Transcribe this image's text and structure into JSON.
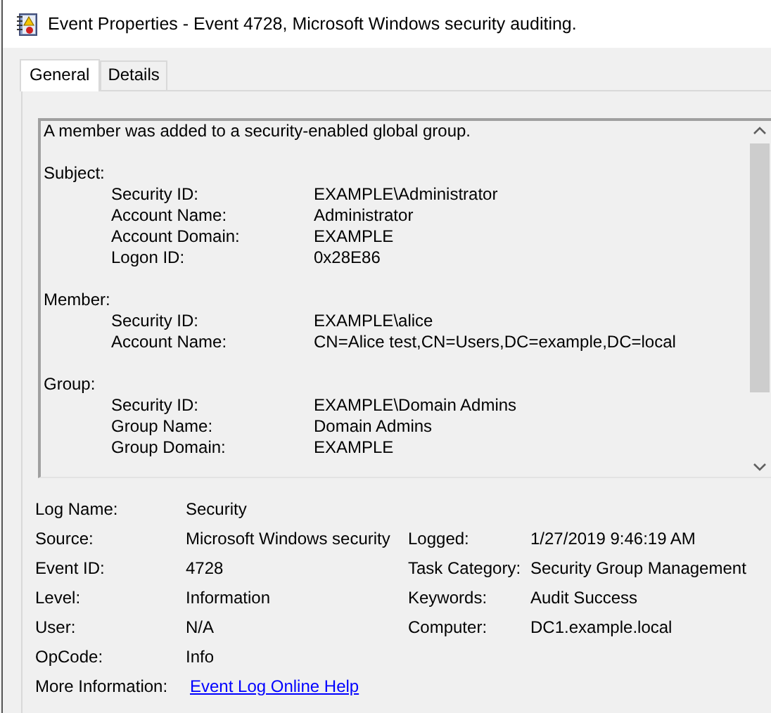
{
  "window": {
    "title": "Event Properties - Event 4728, Microsoft Windows security auditing."
  },
  "tabs": [
    {
      "label": "General",
      "selected": true
    },
    {
      "label": "Details",
      "selected": false
    }
  ],
  "description": {
    "summary": "A member was added to a security-enabled global group.",
    "sections": [
      {
        "heading": "Subject:",
        "fields": [
          {
            "label": "Security ID:",
            "value": "EXAMPLE\\Administrator"
          },
          {
            "label": "Account Name:",
            "value": "Administrator"
          },
          {
            "label": "Account Domain:",
            "value": "EXAMPLE"
          },
          {
            "label": "Logon ID:",
            "value": "0x28E86"
          }
        ]
      },
      {
        "heading": "Member:",
        "fields": [
          {
            "label": "Security ID:",
            "value": "EXAMPLE\\alice"
          },
          {
            "label": "Account Name:",
            "value": "CN=Alice test,CN=Users,DC=example,DC=local"
          }
        ]
      },
      {
        "heading": "Group:",
        "fields": [
          {
            "label": "Security ID:",
            "value": "EXAMPLE\\Domain Admins"
          },
          {
            "label": "Group Name:",
            "value": "Domain Admins"
          },
          {
            "label": "Group Domain:",
            "value": "EXAMPLE"
          }
        ]
      }
    ]
  },
  "details": [
    {
      "left": {
        "label": "Log Name:",
        "value": "Security"
      }
    },
    {
      "left": {
        "label": "Source:",
        "value": "Microsoft Windows security"
      },
      "right": {
        "label": "Logged:",
        "value": "1/27/2019 9:46:19 AM"
      }
    },
    {
      "left": {
        "label": "Event ID:",
        "value": "4728"
      },
      "right": {
        "label": "Task Category:",
        "value": "Security Group Management"
      }
    },
    {
      "left": {
        "label": "Level:",
        "value": "Information"
      },
      "right": {
        "label": "Keywords:",
        "value": "Audit Success"
      }
    },
    {
      "left": {
        "label": "User:",
        "value": "N/A"
      },
      "right": {
        "label": "Computer:",
        "value": "DC1.example.local"
      }
    },
    {
      "left": {
        "label": "OpCode:",
        "value": "Info"
      }
    }
  ],
  "more_information": {
    "label": "More Information:",
    "link": "Event Log Online Help"
  }
}
